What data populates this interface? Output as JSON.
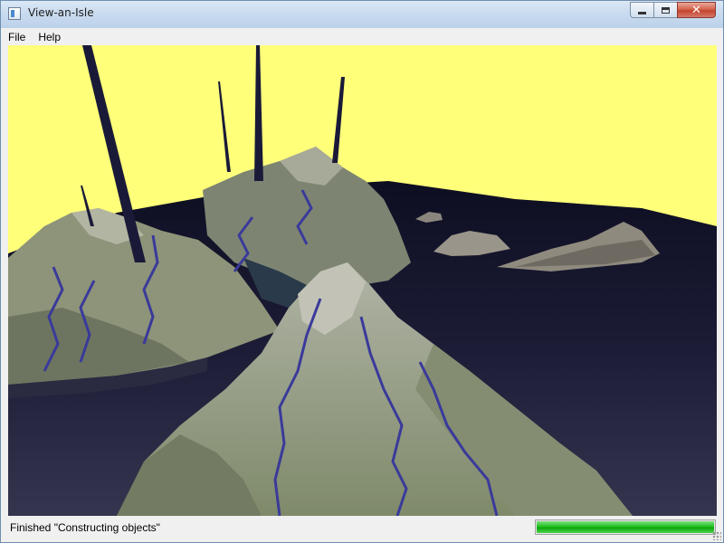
{
  "window": {
    "title": "View-an-Isle"
  },
  "menu": {
    "file_label": "File",
    "help_label": "Help"
  },
  "status": {
    "message": "Finished \"Constructing objects\"",
    "progress_fraction": 1.0
  },
  "scene": {
    "sky_color": "#ffff7a",
    "sea_color": "#24243c",
    "terrain_color": "#8a9478",
    "river_color": "#3a3a9a"
  },
  "icons": {
    "app": "window-app-icon",
    "minimize": "minimize-icon",
    "maximize": "maximize-icon",
    "close": "close-icon"
  }
}
